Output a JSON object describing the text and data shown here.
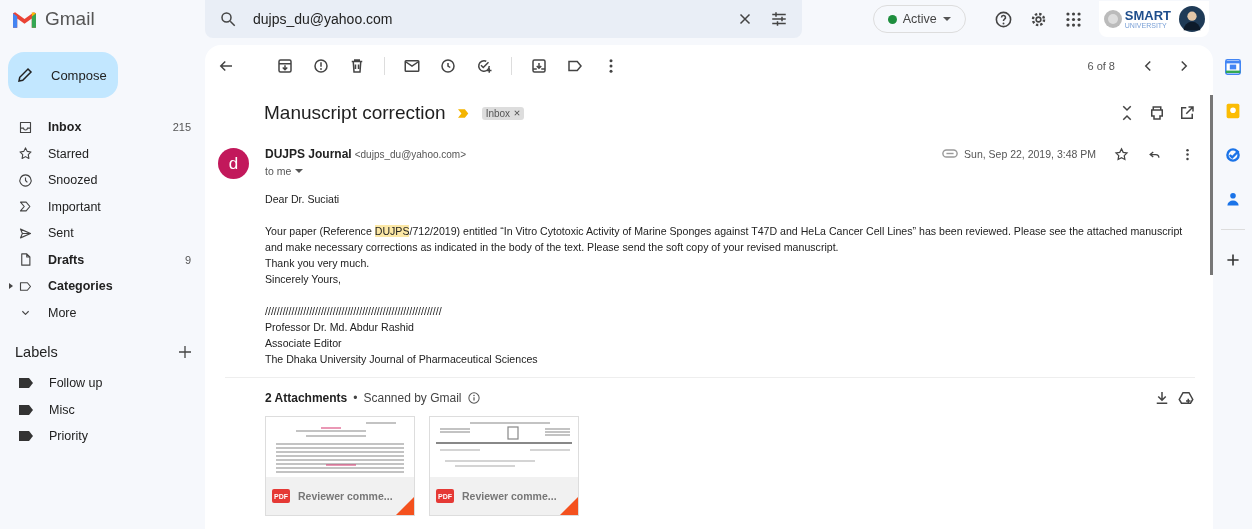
{
  "app": {
    "name": "Gmail"
  },
  "search": {
    "value": "dujps_du@yahoo.com"
  },
  "status": {
    "label": "Active",
    "color": "#1e8e3e"
  },
  "account": {
    "logo_text": "SMART",
    "logo_subtext": "UNIVERSITY"
  },
  "compose": {
    "label": "Compose"
  },
  "nav": [
    {
      "label": "Inbox",
      "count": "215",
      "bold": true,
      "expandable": false
    },
    {
      "label": "Starred",
      "bold": false,
      "expandable": false
    },
    {
      "label": "Snoozed",
      "bold": false,
      "expandable": false
    },
    {
      "label": "Important",
      "bold": false,
      "expandable": false
    },
    {
      "label": "Sent",
      "bold": false,
      "expandable": false
    },
    {
      "label": "Drafts",
      "count": "9",
      "bold": true,
      "expandable": false
    },
    {
      "label": "Categories",
      "bold": true,
      "expandable": true
    },
    {
      "label": "More",
      "bold": false,
      "expandable": false
    }
  ],
  "labels": {
    "title": "Labels",
    "items": [
      {
        "label": "Follow up"
      },
      {
        "label": "Misc"
      },
      {
        "label": "Priority"
      }
    ]
  },
  "pager": "6 of 8",
  "message": {
    "subject": "Manuscript correction",
    "chip": "Inbox",
    "avatar_letter": "d",
    "sender_name": "DUJPS Journal",
    "sender_email": "<dujps_du@yahoo.com>",
    "recipient": "to me",
    "date": "Sun, Sep 22, 2019, 3:48 PM",
    "body": [
      {
        "lines": [
          {
            "parts": [
              {
                "text": "Dear Dr. Suciati",
                "highlighted": false
              }
            ]
          }
        ]
      },
      {
        "lines": [
          {
            "parts": [
              {
                "text": "Your paper (Reference ",
                "highlighted": false
              },
              {
                "text": "DUJPS",
                "highlighted": true
              },
              {
                "text": "/712/2019) entitled “In Vitro Cytotoxic Activity of Marine Sponges against T47D and HeLa Cancer Cell Lines” has been reviewed. Please see the attached manuscript and make necessary corrections as indicated in the body of the text. Please send the soft copy of your revised manuscript.",
                "highlighted": false
              }
            ]
          },
          {
            "parts": [
              {
                "text": "Thank you very much.",
                "highlighted": false
              }
            ]
          },
          {
            "parts": [
              {
                "text": "Sincerely Yours,",
                "highlighted": false
              }
            ]
          }
        ]
      },
      {
        "lines": [
          {
            "parts": [
              {
                "text": "////////////////////////////////////////////////////////////",
                "highlighted": false
              }
            ]
          },
          {
            "parts": [
              {
                "text": "Professor Dr. Md. Abdur Rashid",
                "highlighted": false
              }
            ]
          },
          {
            "parts": [
              {
                "text": "Associate Editor",
                "highlighted": false
              }
            ]
          },
          {
            "parts": [
              {
                "text": "The Dhaka University Journal of Pharmaceutical Sciences",
                "highlighted": false
              }
            ]
          }
        ]
      }
    ]
  },
  "attachments": {
    "title": "2 Attachments",
    "separator": "•",
    "scan_note": "Scanned by Gmail",
    "files": [
      {
        "name": "Reviewer comme...",
        "badge": "PDF"
      },
      {
        "name": "Reviewer comme...",
        "badge": "PDF"
      }
    ]
  }
}
